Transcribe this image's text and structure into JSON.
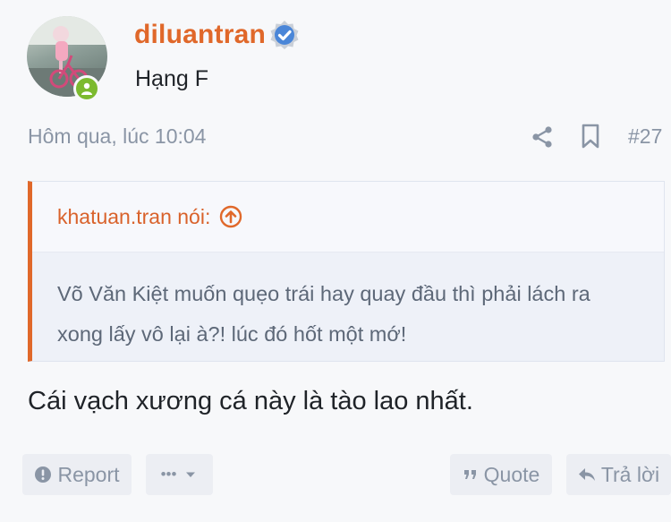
{
  "post": {
    "author": {
      "username": "diluantran",
      "rank": "Hạng F",
      "avatar_icon": "user-avatar-photo",
      "online_icon": "user-online-icon",
      "verified_icon": "verified-badge-icon"
    },
    "meta": {
      "date": "Hôm qua, lúc 10:04",
      "post_number": "#27",
      "share_icon": "share-icon",
      "bookmark_icon": "bookmark-icon"
    },
    "quote": {
      "author_label": "khatuan.tran nói:",
      "jump_icon": "arrow-up-circle-icon",
      "text": "Võ Văn Kiệt muốn quẹo trái hay quay đầu thì phải lách ra xong lấy vô lại à?! lúc đó hốt một mớ!"
    },
    "message": "Cái vạch xương cá này là tào lao nhất.",
    "actions": {
      "report": "Report",
      "more": "•••",
      "quote": "Quote",
      "reply": "Trả lời"
    }
  },
  "colors": {
    "accent": "#e0682a",
    "muted": "#8a95a5",
    "online": "#7cba2f",
    "verified": "#4a86d8",
    "background": "#f7f8fa"
  }
}
